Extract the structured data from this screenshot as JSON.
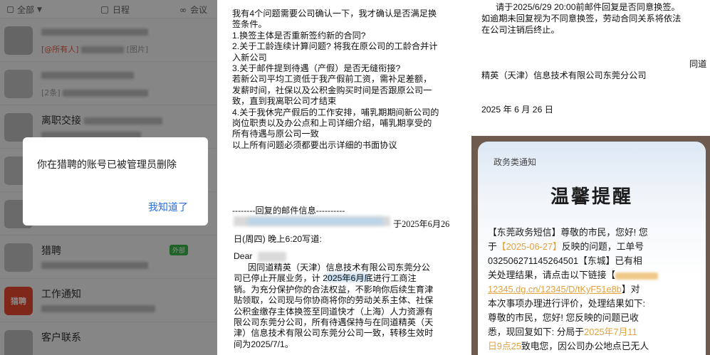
{
  "chat": {
    "tab_all": "全部",
    "tab_calendar": "日程",
    "tab_meeting": "会议",
    "rows": [
      {
        "sub_mention": "[@所有人]",
        "sub_tag": "[图片]"
      },
      {
        "sub_prefix": "[2条]"
      },
      {
        "title": "离职交接"
      },
      {},
      {},
      {
        "title": "猎聘",
        "tag": "外部"
      },
      {
        "title": "工作通知",
        "icon_text": "猎聘"
      },
      {
        "title": "客户联系"
      }
    ],
    "modal": {
      "message": "你在猎聘的账号已被管理员删除",
      "button": "我知道了"
    }
  },
  "email": {
    "lines": [
      "我有4个问题需要公司确认一下，我才确认是否满足换",
      "签条件。",
      "1.换签主体是否重新签约新的合同?",
      "2.关于工龄连续计算问题? 将我在原公司的工龄合并计",
      "入新公司",
      "3.关于邮件提到待遇（产假）是否无缝衔接?",
      "若新公司平均工资低于我产假前工资，需补足差额，",
      "发薪时间，社保以及公积金购买时间是否跟原公司一",
      "致，直到我离职公司才结束",
      "4.关于我休完产假后的工作安排，哺乳期期间新公司的",
      "岗位职责以及办公点和上司详细介绍，哺乳期享受的",
      "所有待遇与原公司一致",
      "以上所有问题必须都要出示详细的书面协议"
    ],
    "separator": "--------回复的邮件信息----------",
    "date": "于2025年6月26",
    "time_line": "日(周四) 晚上6:20写道:",
    "dear": "Dear",
    "body": [
      "因同道精英（天津）信息技术有限公司东莞分公",
      "司已停止开展业务，计        2025年6月底进行工商注",
      "销。为充分保护你的合法权益，不影响你后续生育津",
      "贴领取，公司现与你协商将你的劳动关系主体、社保",
      "公积金缴存主体换签至同道快才（上海）人力资源有",
      "限公司东莞分公司，所有待遇保持与在同道精英（天",
      "津）信息技术有限公司东莞分公司一致，转移生效时",
      "间为2025/7/1。"
    ]
  },
  "email_tail": {
    "line1": "请于2025/6/29 20:00前邮件回复是否同意换签。",
    "line2": "如逾期未回复视为不同意换签，劳动合同关系将依法",
    "line3": "在公司注销后终止。",
    "sign_right": "同道",
    "company": "精英（天津）信息技术有限公司东莞分公司",
    "date": "2025 年 6 月 26 日"
  },
  "notice": {
    "category": "政务类通知",
    "title": "温馨提醒",
    "b1": "【东莞政务短信】尊敬的市民，您好! 您",
    "b2a": "于",
    "b2b": "【2025-06-27】",
    "b2c": "反映的问题，工单号",
    "b3": "032506271145264501【东城】已有相",
    "b4": "关处理结果，请点击以下链接【",
    "b5": "12345.dg.cn/12345/D/tKyF51e8b",
    "b5b": "】对",
    "b6": "本次事项办理进行评价，处理结果如下:",
    "b7": "尊敬的市民，您好! 您反映的问题已收",
    "b8a": "悉，现回复如下: 分局于",
    "b8b": "2025年7月11",
    "b9a": "日9点25",
    "b9b": "致电您，因公司办公地点已无人"
  }
}
